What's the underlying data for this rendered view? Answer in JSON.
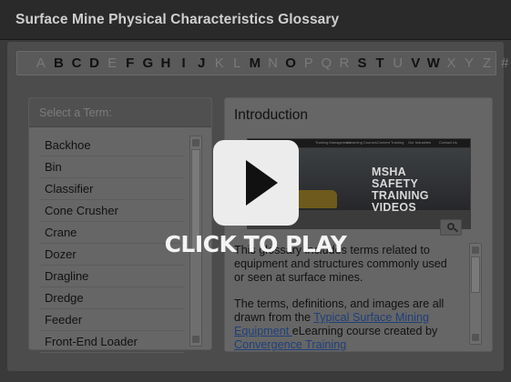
{
  "window": {
    "title": "Surface Mine Physical Characteristics Glossary"
  },
  "alphabet": [
    {
      "letter": "A",
      "enabled": false
    },
    {
      "letter": "B",
      "enabled": true
    },
    {
      "letter": "C",
      "enabled": true
    },
    {
      "letter": "D",
      "enabled": true
    },
    {
      "letter": "E",
      "enabled": false
    },
    {
      "letter": "F",
      "enabled": true
    },
    {
      "letter": "G",
      "enabled": true
    },
    {
      "letter": "H",
      "enabled": true
    },
    {
      "letter": "I",
      "enabled": true
    },
    {
      "letter": "J",
      "enabled": true
    },
    {
      "letter": "K",
      "enabled": false
    },
    {
      "letter": "L",
      "enabled": false
    },
    {
      "letter": "M",
      "enabled": true
    },
    {
      "letter": "N",
      "enabled": false
    },
    {
      "letter": "O",
      "enabled": true
    },
    {
      "letter": "P",
      "enabled": false
    },
    {
      "letter": "Q",
      "enabled": false
    },
    {
      "letter": "R",
      "enabled": false
    },
    {
      "letter": "S",
      "enabled": true
    },
    {
      "letter": "T",
      "enabled": true
    },
    {
      "letter": "U",
      "enabled": false
    },
    {
      "letter": "V",
      "enabled": true
    },
    {
      "letter": "W",
      "enabled": true
    },
    {
      "letter": "X",
      "enabled": false
    },
    {
      "letter": "Y",
      "enabled": false
    },
    {
      "letter": "Z",
      "enabled": false
    },
    {
      "letter": "#",
      "enabled": false
    }
  ],
  "term_panel": {
    "heading": "Select a Term:",
    "terms": [
      "Backhoe",
      "Bin",
      "Classifier",
      "Cone Crusher",
      "Crane",
      "Dozer",
      "Dragline",
      "Dredge",
      "Feeder",
      "Front-End Loader"
    ]
  },
  "content_panel": {
    "heading": "Introduction",
    "image": {
      "nav_items": [
        "Training Management",
        "eLearning Courses",
        "Content Training",
        "Our Industries",
        "Contact Us"
      ],
      "brand": "TRAINING",
      "poster_lines": [
        "MSHA",
        "SAFETY",
        "TRAINING",
        "VIDEOS"
      ]
    },
    "paragraph1": "This glossary includes terms related to equipment and structures commonly used or seen at surface mines.",
    "paragraph2_before": "The terms, definitions, and images are all drawn from the ",
    "paragraph2_link": "Typical Surface Mining Equipment ",
    "paragraph2_after": "eLearning course created by",
    "paragraph2_link2": "Convergence Training"
  },
  "player": {
    "label": "CLICK TO PLAY"
  },
  "colors": {
    "accent_link": "#1f3f7a",
    "play_button": "#ececec"
  },
  "icons": {
    "zoom": "magnifier-icon",
    "play": "play-icon"
  }
}
